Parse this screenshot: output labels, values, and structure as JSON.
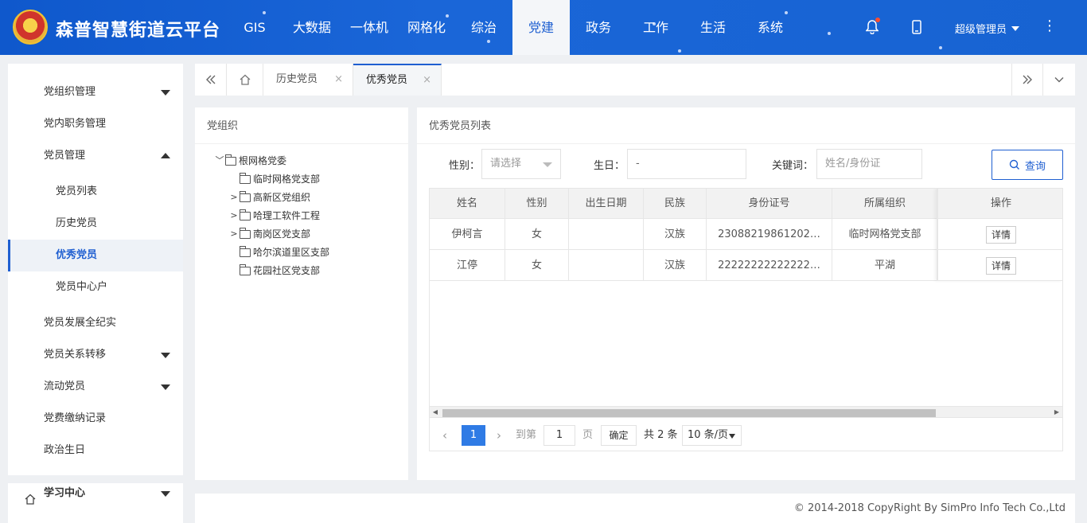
{
  "brand": {
    "title": "森普智慧街道云平台"
  },
  "nav": [
    "GIS",
    "大数据",
    "一体机",
    "网格化",
    "综治",
    "党建",
    "政务",
    "工作",
    "生活",
    "系统"
  ],
  "header": {
    "user": "超级管理员"
  },
  "sidebar": {
    "items": [
      {
        "label": "党组织管理"
      },
      {
        "label": "党内职务管理"
      },
      {
        "label": "党员管理"
      },
      {
        "label": "党员列表"
      },
      {
        "label": "历史党员"
      },
      {
        "label": "优秀党员"
      },
      {
        "label": "党员中心户"
      },
      {
        "label": "党员发展全纪实"
      },
      {
        "label": "党员关系转移"
      },
      {
        "label": "流动党员"
      },
      {
        "label": "党费缴纳记录"
      },
      {
        "label": "政治生日"
      },
      {
        "label": "学习中心"
      }
    ]
  },
  "tabs": [
    {
      "label": "历史党员"
    },
    {
      "label": "优秀党员"
    }
  ],
  "left_panel": {
    "title": "党组织",
    "tree": [
      "根网格党委",
      "临时网格党支部",
      "高新区党组织",
      "哈理工软件工程",
      "南岗区党支部",
      "哈尔滨道里区支部",
      "花园社区党支部"
    ]
  },
  "right_panel": {
    "title": "优秀党员列表",
    "filters": {
      "gender_label": "性别：",
      "gender_placeholder": "请选择",
      "birthday_label": "生日：",
      "birthday_value": "-",
      "keyword_label": "关键词：",
      "keyword_placeholder": "姓名/身份证",
      "query_label": "查询"
    },
    "columns": [
      "姓名",
      "性别",
      "出生日期",
      "民族",
      "身份证号",
      "所属组织",
      "操作"
    ],
    "rows": [
      {
        "name": "伊柯言",
        "gender": "女",
        "birth": "",
        "ethnic": "汉族",
        "id": "23088219861202…",
        "org": "临时网格党支部",
        "op": "详情"
      },
      {
        "name": "江停",
        "gender": "女",
        "birth": "",
        "ethnic": "汉族",
        "id": "22222222222222…",
        "org": "平湖",
        "op": "详情"
      }
    ],
    "pager": {
      "current": "1",
      "goto_label": "到第",
      "goto_value": "1",
      "page_label": "页",
      "ok_label": "确定",
      "total_label": "共 2 条",
      "size_label": "10 条/页"
    }
  },
  "footer": {
    "copyright": "© 2014-2018 CopyRight By SimPro Info Tech Co.,Ltd"
  },
  "colors": {
    "primary": "#1f5fd1",
    "header_bg": "#1763d2",
    "page_bg": "#eef0f3"
  }
}
